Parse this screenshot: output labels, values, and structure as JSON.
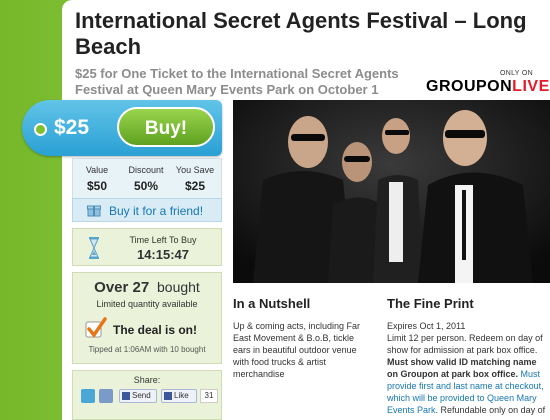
{
  "deal": {
    "title": "International Secret Agents Festival – Long Beach",
    "subtitle": "$25 for One Ticket to the International Secret Agents Festival at Queen Mary Events Park on October 1",
    "only_on": "ONLY ON",
    "logo_part1": "GROUPON",
    "logo_part2": "LIVE"
  },
  "price_tag": {
    "price": "$25",
    "buy_label": "Buy!"
  },
  "stats": [
    {
      "label": "Value",
      "value": "$50"
    },
    {
      "label": "Discount",
      "value": "50%"
    },
    {
      "label": "You Save",
      "value": "$25"
    }
  ],
  "gift": {
    "label": "Buy it for a friend!"
  },
  "timer": {
    "label": "Time Left To Buy",
    "value": "14:15:47"
  },
  "bought": {
    "prefix": "Over 27",
    "suffix": "bought",
    "limited": "Limited quantity available",
    "deal_on": "The deal is on!",
    "tipped": "Tipped at 1:06AM with 10 bought"
  },
  "share": {
    "label": "Share:",
    "send": "Send",
    "like": "Like",
    "like_count": "31"
  },
  "nutshell": {
    "title": "In a Nutshell",
    "text": "Up & coming acts, including Far East Movement & B.o.B, tickle ears in beautiful outdoor venue with food trucks & artist merchandise"
  },
  "fine_print": {
    "title": "The Fine Print",
    "line1": "Expires Oct 1, 2011",
    "line2": "Limit 12 per person. Redeem on day of show for admission at park box office.",
    "bold": "Must show valid ID matching name on Groupon at park box office.",
    "link": "Must provide first and last name at checkout, which will be provided to Queen Mary Events Park.",
    "tail": "Refundable only on day of"
  },
  "colors": {
    "accent_green": "#7fbf2e",
    "tag_blue": "#2aa0d4",
    "link_blue": "#1577b3",
    "live_red": "#e21c2a"
  }
}
